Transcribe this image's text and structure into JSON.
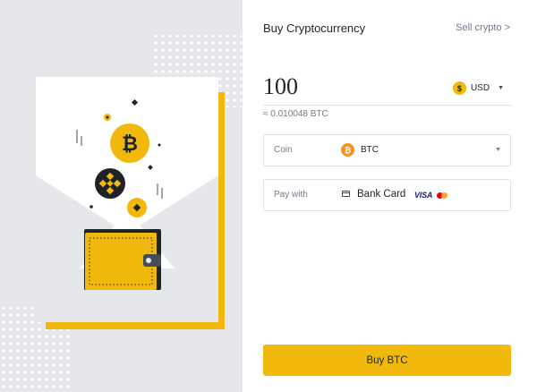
{
  "form": {
    "title": "Buy Cryptocurrency",
    "sell_link": "Sell crypto >",
    "amount": "100",
    "currency_symbol": "$",
    "currency": "USD",
    "estimate": "≈ 0.010048 BTC",
    "coin_label": "Coin",
    "coin_value": "BTC",
    "pay_label": "Pay with",
    "pay_value": "Bank Card",
    "card_brand": "VISA",
    "buy_button": "Buy BTC"
  },
  "icons": {
    "bitcoin_symbol": "₿",
    "caret": "▼"
  },
  "colors": {
    "accent": "#f0b90b",
    "btc_orange": "#f7931a",
    "panel_bg": "#e6e7ea",
    "text": "#1e2329",
    "muted": "#707a8a"
  }
}
